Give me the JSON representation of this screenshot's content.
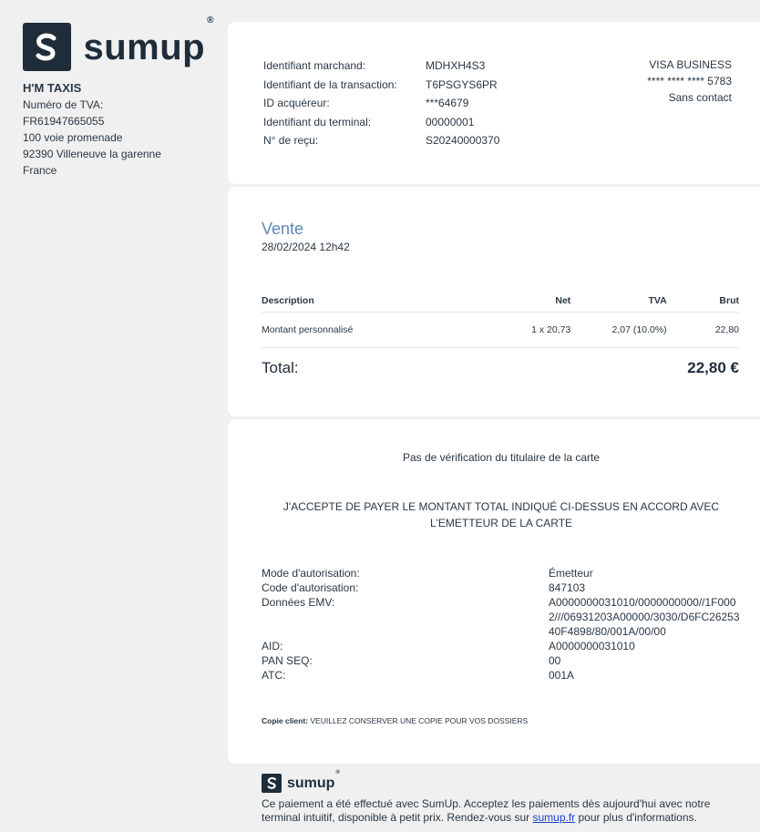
{
  "brand": {
    "name": "sumup",
    "reg": "®"
  },
  "merchant": {
    "name": "H'M TAXIS",
    "vat_label": "Numéro de TVA:",
    "vat_number": "FR61947665055",
    "address_line1": "100 voie promenade",
    "address_line2": "92390 Villeneuve la garenne",
    "country": "France"
  },
  "transaction": {
    "rows": [
      {
        "label": "Identifiant marchand:",
        "value": "MDHXH4S3"
      },
      {
        "label": "Identifiant de la transaction:",
        "value": "T6PSGYS6PR"
      },
      {
        "label": "ID acquéreur:",
        "value": "***64679"
      },
      {
        "label": "Identifiant du terminal:",
        "value": "00000001"
      },
      {
        "label": "N° de reçu:",
        "value": "S20240000370"
      }
    ],
    "card_type": "VISA BUSINESS",
    "card_number": "**** **** **** 5783",
    "entry_mode": "Sans contact"
  },
  "sale": {
    "title": "Vente",
    "date": "28/02/2024 12h42",
    "headers": {
      "description": "Description",
      "net": "Net",
      "tva": "TVA",
      "brut": "Brut"
    },
    "items": [
      {
        "description": "Montant personnalisé",
        "net": "1 x 20,73",
        "tva": "2,07 (10.0%)",
        "brut": "22,80"
      }
    ],
    "total_label": "Total:",
    "total_value": "22,80 €"
  },
  "verification": {
    "no_verification": "Pas de vérification du titulaire de la carte",
    "acceptance": "J'ACCEPTE DE PAYER LE MONTANT TOTAL INDIQUÉ CI-DESSUS EN ACCORD AVEC L'EMETTEUR DE LA CARTE",
    "rows": [
      {
        "label": "Mode d'autorisation:",
        "value": "Émetteur"
      },
      {
        "label": "Code d'autorisation:",
        "value": "847103"
      },
      {
        "label": "Données EMV:",
        "value": "A0000000031010/0000000000//1F0002///06931203A00000/3030/D6FC2625340F4898/80/001A/00/00"
      },
      {
        "label": "AID:",
        "value": "A0000000031010"
      },
      {
        "label": "PAN SEQ:",
        "value": "00"
      },
      {
        "label": "ATC:",
        "value": "001A"
      }
    ],
    "copy_label": "Copie client:",
    "copy_text": "VEUILLEZ CONSERVER UNE COPIE POUR VOS DOSSIERS"
  },
  "footer": {
    "text_before": "Ce paiement a été effectué avec SumUp. Acceptez les paiements dès aujourd'hui avec notre terminal intuitif, disponible à petit prix. Rendez-vous sur ",
    "link": "sumup.fr",
    "text_after": " pour plus d'informations."
  }
}
